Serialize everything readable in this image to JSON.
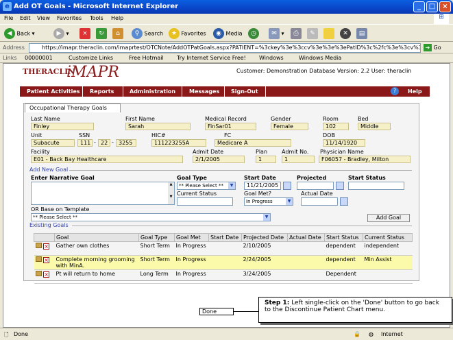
{
  "window": {
    "title": "Add OT Goals - Microsoft Internet Explorer"
  },
  "menu": [
    "File",
    "Edit",
    "View",
    "Favorites",
    "Tools",
    "Help"
  ],
  "toolbar": {
    "back": "Back",
    "search": "Search",
    "favorites": "Favorites",
    "media": "Media"
  },
  "address": {
    "label": "Address",
    "url": "https://imapr.theraclin.com/imaprtest/OTCNote/AddOTPatGoals.aspx?PATIENT=%3ckey%3e%3ccv%3e%3e%3ePatID%3c%2fc%3e%3cv%3",
    "go": "Go"
  },
  "links": {
    "label": "Links",
    "items": [
      "00000001",
      "Customize Links",
      "Free Hotmail",
      "Try Internet Service Free!",
      "Windows",
      "Windows Media"
    ]
  },
  "app": {
    "logo_theraclin": "THERACLIN",
    "logo_imapr": "iMAPR",
    "customer_line": "Customer: Demonstration Database Version: 2.2 User: theraclin",
    "nav": [
      "Patient Activities",
      "Reports",
      "Administration",
      "Messages",
      "Sign-Out"
    ],
    "help": "Help",
    "tab": "Occupational Therapy Goals",
    "patient": {
      "last_name_label": "Last Name",
      "last_name": "Finley",
      "first_name_label": "First Name",
      "first_name": "Sarah",
      "medical_record_label": "Medical Record",
      "medical_record": "FinSar01",
      "gender_label": "Gender",
      "gender": "Female",
      "room_label": "Room",
      "room": "102",
      "bed_label": "Bed",
      "bed": "Middle",
      "unit_label": "Unit",
      "unit": "Subacute",
      "ssn_label": "SSN",
      "ssn1": "111",
      "ssn2": "22",
      "ssn3": "3255",
      "hic_label": "HIC#",
      "hic": "111223255A",
      "fc_label": "FC",
      "fc": "Medicare A",
      "dob_label": "DOB",
      "dob": "11/14/1920",
      "facility_label": "Facility",
      "facility": "E01 - Back Bay Healthcare",
      "admit_date_label": "Admit Date",
      "admit_date": "2/1/2005",
      "plan_label": "Plan",
      "plan": "1",
      "admit_no_label": "Admit No.",
      "admit_no": "1",
      "physician_label": "Physician Name",
      "physician": "F06057 - Bradley, Milton"
    },
    "add_goal": {
      "section": "Add New Goal",
      "narrative_label": "Enter Narrative Goal",
      "goal_type_label": "Goal Type",
      "goal_type_value": "** Please Select **",
      "start_date_label": "Start Date",
      "start_date_value": "11/21/2005",
      "projected_label": "Projected",
      "start_status_label": "Start Status",
      "current_status_label": "Current Status",
      "goal_met_label": "Goal Met?",
      "goal_met_value": "In Progress",
      "actual_date_label": "Actual Date",
      "template_label": "OR Base on Template",
      "template_value": "** Please Select **",
      "add_button": "Add Goal"
    },
    "existing": {
      "section": "Existing Goals",
      "headers": [
        "",
        "Goal",
        "Goal Type",
        "Goal Met",
        "Start Date",
        "Projected Date",
        "Actual Date",
        "Start Status",
        "Current Status"
      ],
      "rows": [
        {
          "goal": "Gather own clothes",
          "type": "Short Term",
          "met": "In Progress",
          "start": "",
          "projected": "2/10/2005",
          "actual": "",
          "start_status": "dependent",
          "current_status": "independent"
        },
        {
          "goal": "Complete morning grooming with MinA.",
          "type": "Short Term",
          "met": "In Progress",
          "start": "",
          "projected": "2/24/2005",
          "actual": "",
          "start_status": "dependent",
          "current_status": "Min Assist"
        },
        {
          "goal": "Pt will return to home",
          "type": "Long Term",
          "met": "In Progress",
          "start": "",
          "projected": "3/24/2005",
          "actual": "",
          "start_status": "Dependent",
          "current_status": ""
        }
      ]
    },
    "done": "Done",
    "callout_bold": "Step 1:",
    "callout_text": " Left single-click on the 'Done' button to go back to the Discontinue Patient Chart menu."
  },
  "status": {
    "left": "Done",
    "zone": "Internet"
  }
}
